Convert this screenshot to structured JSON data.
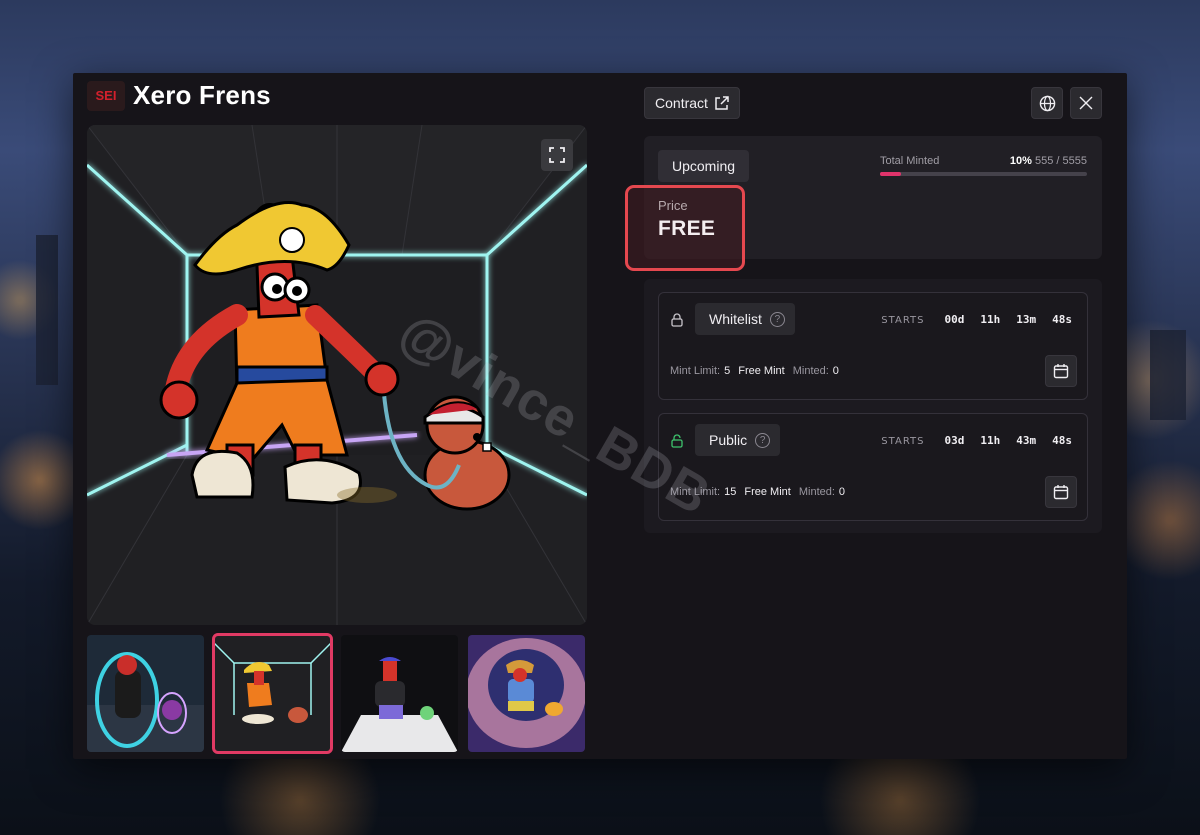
{
  "header": {
    "chain_badge": "SEI",
    "collection_name": "Xero Frens"
  },
  "toolbar": {
    "contract_label": "Contract",
    "globe_icon": "globe-icon",
    "x_icon": "x-logo-icon"
  },
  "gallery": {
    "expand_icon": "expand-icon",
    "selected_index": 1,
    "thumbnails": [
      {
        "name": "thumb-aura-character"
      },
      {
        "name": "thumb-pirate-character"
      },
      {
        "name": "thumb-cap-character"
      },
      {
        "name": "thumb-viking-character"
      }
    ]
  },
  "mint_stats": {
    "status": "Upcoming",
    "total_minted_label": "Total Minted",
    "percent": "10%",
    "count": "555 / 5555",
    "progress_fraction": 0.1,
    "accent": "#e0336b"
  },
  "price": {
    "label": "Price",
    "value": "FREE"
  },
  "phases": [
    {
      "name": "Whitelist",
      "lock_state": "locked",
      "starts_label": "STARTS",
      "countdown": [
        "00d",
        "11h",
        "13m",
        "48s"
      ],
      "mint_limit_label": "Mint Limit:",
      "mint_limit": "5",
      "free_label": "Free Mint",
      "minted_label": "Minted:",
      "minted": "0"
    },
    {
      "name": "Public",
      "lock_state": "unlocked",
      "starts_label": "STARTS",
      "countdown": [
        "03d",
        "11h",
        "43m",
        "48s"
      ],
      "mint_limit_label": "Mint Limit:",
      "mint_limit": "15",
      "free_label": "Free Mint",
      "minted_label": "Minted:",
      "minted": "0"
    }
  ],
  "watermark": "@vince_BDB"
}
